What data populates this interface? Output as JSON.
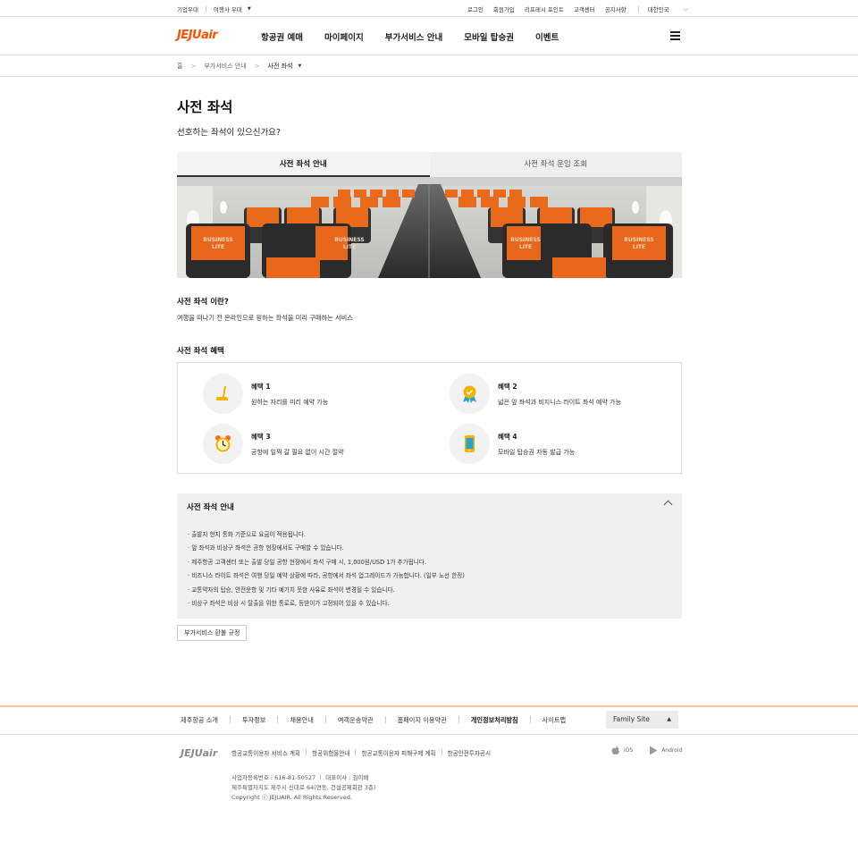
{
  "topbar": {
    "corp": "기업우대",
    "agency": "여행사 우대",
    "links": [
      "로그인",
      "회원가입",
      "리프레시 포인트",
      "고객센터",
      "공지사항"
    ],
    "region": "대한민국"
  },
  "brand": {
    "logo_text": "JEJUair",
    "accent": "#ff5000"
  },
  "gnb": [
    "항공권 예매",
    "마이페이지",
    "부가서비스 안내",
    "모바일 탑승권",
    "이벤트"
  ],
  "breadcrumb": {
    "home": "홈",
    "parent": "부가서비스 안내",
    "current": "사전 좌석"
  },
  "page": {
    "title": "사전 좌석",
    "subtitle": "선호하는 좌석이 있으신가요?"
  },
  "tabs": [
    {
      "label": "사전 좌석 안내",
      "active": true
    },
    {
      "label": "사전 좌석 운임 조회",
      "active": false
    }
  ],
  "banner": {
    "seat_label_1": "BUSINESS",
    "seat_label_2": "LITE"
  },
  "what": {
    "heading": "사전 좌석 이란?",
    "text": "여행을 떠나기 전 온라인으로 원하는 좌석을 미리 구매하는 서비스"
  },
  "benefits": {
    "heading": "사전 좌석 혜택",
    "items": [
      {
        "title": "혜택 1",
        "desc": "원하는 자리를 미리 예약 가능",
        "icon": "seat-icon"
      },
      {
        "title": "혜택 2",
        "desc": "넓은 앞 좌석과 비지니스 라이트 좌석 예약 가능",
        "icon": "medal-icon"
      },
      {
        "title": "혜택 3",
        "desc": "공항에 일찍 갈 필요 없이 시간 절약",
        "icon": "alarm-clock-icon"
      },
      {
        "title": "혜택 4",
        "desc": "모바일 탑승권 자동 발급 가능",
        "icon": "smartphone-icon"
      }
    ]
  },
  "guide": {
    "heading": "사전 좌석 안내",
    "items": [
      "· 출발지 현지 통화 기준으로 요금이 적용됩니다.",
      "· 앞 좌석과 비상구 좌석은 공항 현장에서도 구매할 수 있습니다.",
      "· 제주항공 고객센터 또는 출발 당일 공항 현장에서 좌석 구매 시, 1,000원/USD 1가 추가됩니다.",
      "· 비즈니스 라이트 좌석은 여행 당일 예약 상황에 따라, 공항에서 좌석 업그레이드가 가능합니다. (일부 노선 한정)",
      "· 교통약자의 탑승, 안전운항 및 기타 예기치 못한 사유로 좌석이 변경될 수 있습니다.",
      "· 비상구 좌석은 비상 시 탈출을 위한 통로로, 등받이가 고정되어 있을 수 있습니다."
    ]
  },
  "refund_button": "부가서비스 환불 규정",
  "footer": {
    "links": [
      "제주항공 소개",
      "투자정보",
      "채용안내",
      "여객운송약관",
      "홈페이지 이용약관",
      "개인정보처리방침",
      "사이트맵"
    ],
    "family_site": "Family Site",
    "policies": [
      "항공교통이용자 서비스 계획",
      "항공위험물안내",
      "항공교통이용자 피해구제 계획",
      "항공안전투자공시"
    ],
    "apps": [
      "iOS",
      "Android"
    ],
    "biz_no": "사업자등록번호 : 616-81-50527",
    "ceo": "대표이사 : 김이배",
    "address": "제주특별자치도 제주시 신대로 64(연동, 건설공제회관 3층)",
    "copyright": "Copyright ⓒ JEJUAIR. All Rights Reserved."
  }
}
